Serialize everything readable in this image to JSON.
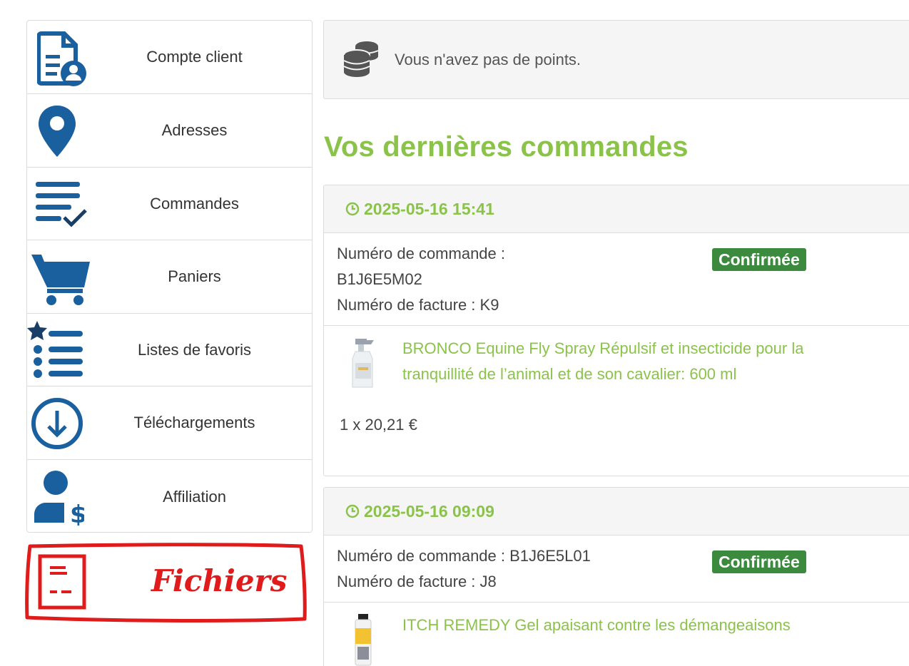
{
  "menu": {
    "items": [
      {
        "label": "Compte client",
        "icon": "account-document-icon"
      },
      {
        "label": "Adresses",
        "icon": "map-pin-icon"
      },
      {
        "label": "Commandes",
        "icon": "order-list-check-icon"
      },
      {
        "label": "Paniers",
        "icon": "cart-icon"
      },
      {
        "label": "Listes de favoris",
        "icon": "favorites-list-icon"
      },
      {
        "label": "Téléchargements",
        "icon": "download-circle-icon"
      },
      {
        "label": "Affiliation",
        "icon": "user-dollar-icon"
      }
    ]
  },
  "annotation": {
    "label": "Fichiers",
    "icon": "file-document-sketch-icon",
    "color": "#e01b1b"
  },
  "points": {
    "icon": "coins-stack-icon",
    "text": "Vous n'avez pas de points."
  },
  "orders_section": {
    "title": "Vos dernières commandes"
  },
  "orders": [
    {
      "date": "2025-05-16 15:41",
      "order_number_label": "Numéro de commande :",
      "order_number": "B1J6E5M02",
      "invoice_line": "Numéro de facture : K9",
      "status": "Confirmée",
      "product_name": "BRONCO Equine Fly Spray Répulsif et insecticide pour la tranquillité de l’animal et de son cavalier: 600 ml",
      "quantity_line": "1 x 20,21 €"
    },
    {
      "date": "2025-05-16 09:09",
      "order_number_line": "Numéro de commande : B1J6E5L01",
      "invoice_line": "Numéro de facture : J8",
      "status": "Confirmée",
      "product_name": "ITCH REMEDY Gel apaisant contre les démangeaisons"
    }
  ],
  "colors": {
    "accent_green": "#8bc34a",
    "badge_green": "#3b8a3e",
    "icon_blue": "#1a5f9e"
  }
}
